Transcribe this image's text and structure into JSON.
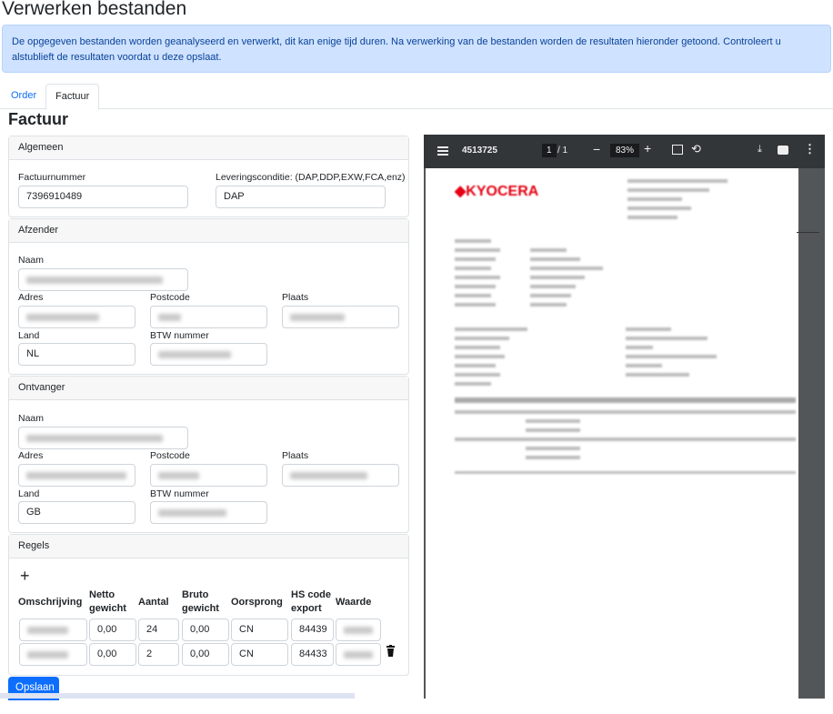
{
  "page_title": "Verwerken bestanden",
  "alert": "De opgegeven bestanden worden geanalyseerd en verwerkt, dit kan enige tijd duren. Na verwerking van de bestanden worden de resultaten hieronder getoond. Controleert u alstublieft de resultaten voordat u deze opslaat.",
  "tabs": [
    "Order",
    "Factuur"
  ],
  "section_title": "Factuur",
  "algemeen": {
    "header": "Algemeen",
    "factuurnummer_label": "Factuurnummer",
    "factuurnummer": "7396910489",
    "levering_label": "Leveringsconditie: (DAP,DDP,EXW,FCA,enz)",
    "levering": "DAP"
  },
  "afzender": {
    "header": "Afzender",
    "naam_label": "Naam",
    "adres_label": "Adres",
    "postcode_label": "Postcode",
    "plaats_label": "Plaats",
    "land_label": "Land",
    "land": "NL",
    "btw_label": "BTW nummer"
  },
  "ontvanger": {
    "header": "Ontvanger",
    "naam_label": "Naam",
    "adres_label": "Adres",
    "postcode_label": "Postcode",
    "plaats_label": "Plaats",
    "land_label": "Land",
    "land": "GB",
    "btw_label": "BTW nummer"
  },
  "regels": {
    "header": "Regels",
    "add": "+",
    "columns": [
      "Omschrijving",
      "Netto gewicht",
      "Aantal",
      "Bruto gewicht",
      "Oorsprong",
      "HS code export",
      "Waarde"
    ],
    "rows": [
      {
        "netto": "0,00",
        "aantal": "24",
        "bruto": "0,00",
        "oorsprong": "CN",
        "hs": "84439"
      },
      {
        "netto": "0,00",
        "aantal": "2",
        "bruto": "0,00",
        "oorsprong": "CN",
        "hs": "84433"
      }
    ]
  },
  "save": "Opslaan",
  "pdf": {
    "title": "4513725",
    "page": "1",
    "pages": "/ 1",
    "zoom": "83%",
    "logo": "KYOCERA",
    "brand_color": "#e60012"
  }
}
